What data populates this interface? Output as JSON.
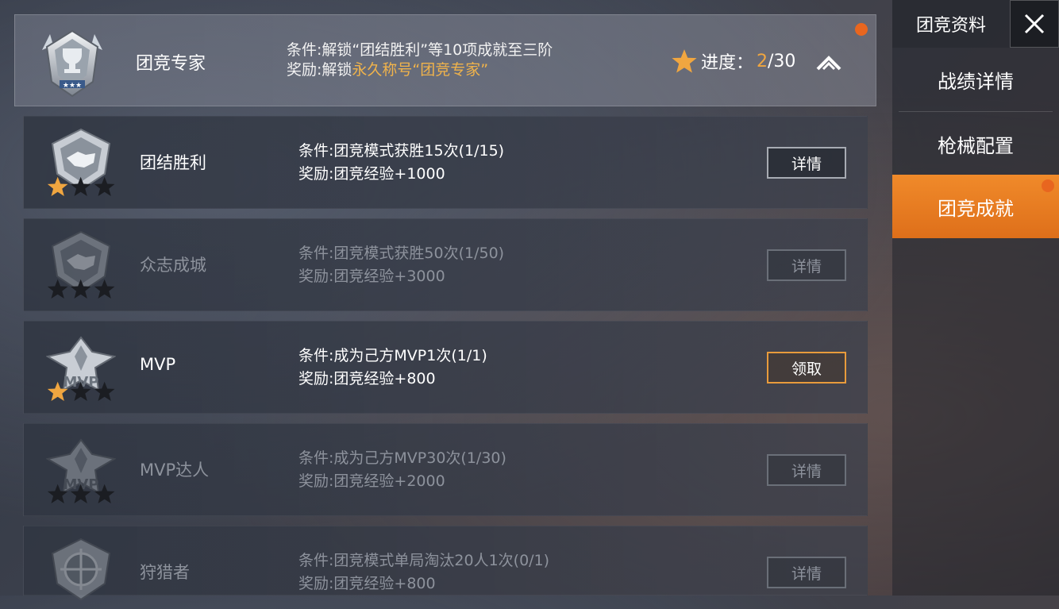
{
  "header": {
    "title": "团竞专家",
    "condition": "条件:解锁“团结胜利”等10项成就至三阶",
    "reward_prefix": "奖励:解锁",
    "reward_highlight": "永久称号“团竞专家”",
    "progress_label": "进度：",
    "progress_current": "2",
    "progress_total": "/30",
    "icons": {
      "badge": "trophy-badge-icon",
      "star": "star-icon",
      "collapse": "chevron-up-icon"
    },
    "colors": {
      "accent": "#f0a640",
      "notify": "#e8661f"
    }
  },
  "achievements": [
    {
      "name": "团结胜利",
      "condition": "条件:团竞模式获胜15次(1/15)",
      "reward": "奖励:团竞经验+1000",
      "button": "详情",
      "stars_filled": 1,
      "unlocked": true,
      "icon": "handshake-badge-icon"
    },
    {
      "name": "众志成城",
      "condition": "条件:团竞模式获胜50次(1/50)",
      "reward": "奖励:团竞经验+3000",
      "button": "详情",
      "stars_filled": 0,
      "unlocked": false,
      "icon": "handshake-badge-icon"
    },
    {
      "name": "MVP",
      "condition": "条件:成为己方MVP1次(1/1)",
      "reward": "奖励:团竞经验+800",
      "button": "领取",
      "stars_filled": 1,
      "unlocked": true,
      "icon": "mvp-eagle-badge-icon"
    },
    {
      "name": "MVP达人",
      "condition": "条件:成为己方MVP30次(1/30)",
      "reward": "奖励:团竞经验+2000",
      "button": "详情",
      "stars_filled": 0,
      "unlocked": false,
      "icon": "mvp-eagle-badge-icon"
    },
    {
      "name": "狩猎者",
      "condition": "条件:团竞模式单局淘汰20人1次(0/1)",
      "reward": "奖励:团竞经验+800",
      "button": "详情",
      "stars_filled": 0,
      "unlocked": false,
      "icon": "crosshair-badge-icon"
    }
  ],
  "sidebar": {
    "title": "团竞资料",
    "close_icon": "close-icon",
    "items": [
      {
        "label": "战绩详情",
        "active": false
      },
      {
        "label": "枪械配置",
        "active": false
      },
      {
        "label": "团竞成就",
        "active": true
      }
    ]
  }
}
